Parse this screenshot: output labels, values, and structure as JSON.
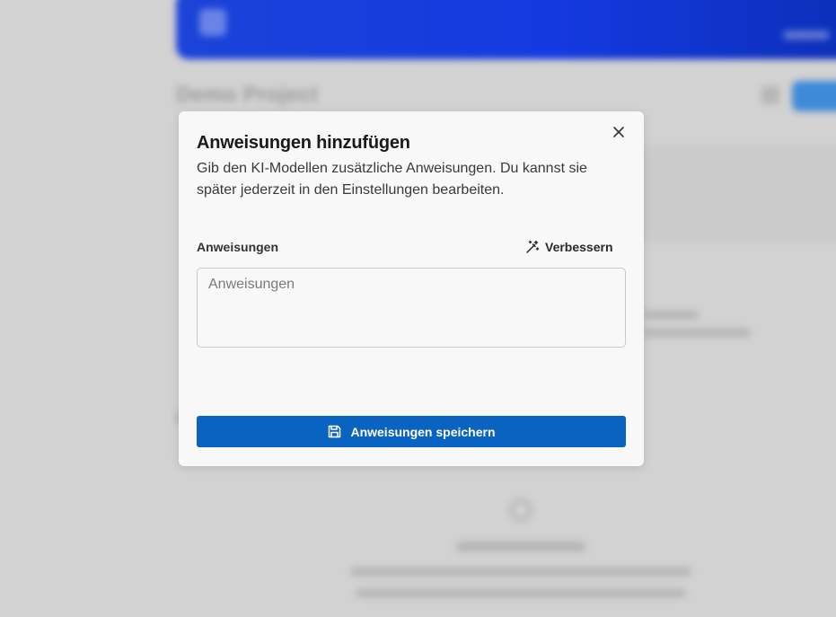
{
  "background": {
    "project_title": "Demo Project"
  },
  "modal": {
    "title": "Anweisungen hinzufügen",
    "description": "Gib den KI-Modellen zusätzliche Anweisungen. Du kannst sie später jederzeit in den Einstellungen bearbeiten.",
    "field_label": "Anweisungen",
    "improve_label": "Verbessern",
    "textarea_value": "",
    "textarea_placeholder": "Anweisungen",
    "save_label": "Anweisungen speichern",
    "close_icon": "close-icon",
    "improve_icon": "magic-wand-icon",
    "save_icon": "floppy-disk-icon"
  },
  "colors": {
    "primary_button": "#0b63c1",
    "banner_gradient_start": "#1b43d8",
    "overlay": "#d2d2d2"
  }
}
